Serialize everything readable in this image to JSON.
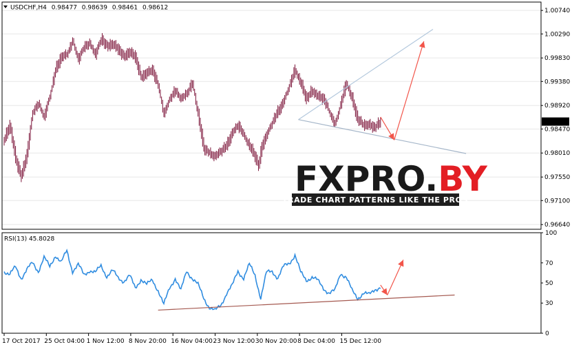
{
  "colors": {
    "background": "#ffffff",
    "frame": "#000000",
    "grid": "#e7e7e7",
    "candle_body": "#7b1338",
    "rsi_line": "#2f8ce0",
    "trend_line_upper": "#b3c8dd",
    "trend_line_lower": "#a5b6c9",
    "rsi_support_line": "#a4584f",
    "arrow": "#f2554a",
    "logo_dark": "#1a1a1a",
    "logo_red": "#e31e24",
    "tag_bar": "#1e1e1e"
  },
  "header": {
    "symbol": "USDCHF,H4",
    "open": "0.98477",
    "high": "0.98639",
    "low": "0.98461",
    "close": "0.98612"
  },
  "watermark": {
    "part1": "FXPRO.",
    "part2": "BY",
    "tagline": "TRADE CHART PATTERNS LIKE THE PROS"
  },
  "chart_data": [
    {
      "type": "candlestick",
      "title": "USDCHF,H4",
      "ylim": [
        0.9655,
        1.009
      ],
      "y_ticks": [
        "1.00740",
        "1.00290",
        "0.99830",
        "0.99380",
        "0.98920",
        "0.98470",
        "0.98010",
        "0.97550",
        "0.97100",
        "0.96640"
      ],
      "current_price": "0.98612",
      "grid": true,
      "close_path": [
        [
          0,
          0.9825
        ],
        [
          5,
          0.9855
        ],
        [
          10,
          0.979
        ],
        [
          15,
          0.9755
        ],
        [
          20,
          0.98
        ],
        [
          25,
          0.988
        ],
        [
          30,
          0.9895
        ],
        [
          35,
          0.987
        ],
        [
          40,
          0.991
        ],
        [
          45,
          0.996
        ],
        [
          50,
          0.9985
        ],
        [
          55,
          0.999
        ],
        [
          60,
          1.0015
        ],
        [
          65,
          0.998
        ],
        [
          70,
          1.0005
        ],
        [
          75,
          1.001
        ],
        [
          80,
          0.999
        ],
        [
          85,
          1.002
        ],
        [
          90,
          1.0005
        ],
        [
          95,
          1.001
        ],
        [
          100,
          1.0
        ],
        [
          105,
          0.9985
        ],
        [
          110,
          0.9995
        ],
        [
          115,
          0.9985
        ],
        [
          120,
          0.9945
        ],
        [
          125,
          0.9955
        ],
        [
          130,
          0.996
        ],
        [
          135,
          0.993
        ],
        [
          140,
          0.9875
        ],
        [
          145,
          0.9905
        ],
        [
          150,
          0.992
        ],
        [
          155,
          0.9905
        ],
        [
          160,
          0.9915
        ],
        [
          165,
          0.9935
        ],
        [
          170,
          0.9875
        ],
        [
          175,
          0.981
        ],
        [
          180,
          0.98
        ],
        [
          185,
          0.9795
        ],
        [
          190,
          0.9805
        ],
        [
          195,
          0.9815
        ],
        [
          200,
          0.984
        ],
        [
          205,
          0.9855
        ],
        [
          210,
          0.9835
        ],
        [
          215,
          0.9815
        ],
        [
          220,
          0.9795
        ],
        [
          223,
          0.9775
        ],
        [
          226,
          0.9815
        ],
        [
          230,
          0.9835
        ],
        [
          235,
          0.986
        ],
        [
          240,
          0.988
        ],
        [
          245,
          0.99
        ],
        [
          250,
          0.993
        ],
        [
          255,
          0.996
        ],
        [
          260,
          0.9935
        ],
        [
          265,
          0.9905
        ],
        [
          270,
          0.992
        ],
        [
          275,
          0.991
        ],
        [
          280,
          0.9905
        ],
        [
          285,
          0.988
        ],
        [
          290,
          0.9855
        ],
        [
          295,
          0.9895
        ],
        [
          300,
          0.9935
        ],
        [
          305,
          0.9905
        ],
        [
          310,
          0.9865
        ],
        [
          315,
          0.9855
        ],
        [
          320,
          0.9855
        ],
        [
          325,
          0.985
        ],
        [
          330,
          0.9861
        ]
      ],
      "x_tick_labels": [
        {
          "bar": 0,
          "label": "17 Oct 2017"
        },
        {
          "bar": 37,
          "label": "25 Oct 04:00"
        },
        {
          "bar": 74,
          "label": "1 Nov 12:00"
        },
        {
          "bar": 111,
          "label": "8 Nov 20:00"
        },
        {
          "bar": 148,
          "label": "16 Nov 04:00"
        },
        {
          "bar": 185,
          "label": "23 Nov 12:00"
        },
        {
          "bar": 222,
          "label": "30 Nov 20:00"
        },
        {
          "bar": 259,
          "label": "8 Dec 04:00"
        },
        {
          "bar": 296,
          "label": "15 Dec 12:00"
        }
      ]
    },
    {
      "type": "line",
      "title": "RSI(13) 45.8028",
      "name": "RSI(13)",
      "ylim": [
        0,
        100
      ],
      "y_ticks": [
        "100",
        "70",
        "50",
        "30",
        "0"
      ],
      "grid": false,
      "values_path": [
        [
          0,
          62
        ],
        [
          5,
          58
        ],
        [
          10,
          66
        ],
        [
          15,
          55
        ],
        [
          20,
          63
        ],
        [
          25,
          70
        ],
        [
          30,
          62
        ],
        [
          35,
          75
        ],
        [
          40,
          66
        ],
        [
          45,
          78
        ],
        [
          50,
          70
        ],
        [
          55,
          82
        ],
        [
          60,
          62
        ],
        [
          65,
          68
        ],
        [
          70,
          58
        ],
        [
          75,
          63
        ],
        [
          80,
          60
        ],
        [
          85,
          67
        ],
        [
          90,
          57
        ],
        [
          95,
          62
        ],
        [
          100,
          55
        ],
        [
          105,
          52
        ],
        [
          110,
          57
        ],
        [
          115,
          45
        ],
        [
          120,
          54
        ],
        [
          125,
          48
        ],
        [
          130,
          53
        ],
        [
          135,
          43
        ],
        [
          140,
          28
        ],
        [
          145,
          45
        ],
        [
          150,
          55
        ],
        [
          155,
          42
        ],
        [
          160,
          62
        ],
        [
          165,
          55
        ],
        [
          170,
          48
        ],
        [
          175,
          35
        ],
        [
          180,
          26
        ],
        [
          185,
          22
        ],
        [
          190,
          28
        ],
        [
          195,
          40
        ],
        [
          200,
          47
        ],
        [
          205,
          62
        ],
        [
          210,
          55
        ],
        [
          215,
          68
        ],
        [
          220,
          58
        ],
        [
          225,
          35
        ],
        [
          230,
          60
        ],
        [
          235,
          62
        ],
        [
          240,
          55
        ],
        [
          245,
          66
        ],
        [
          250,
          70
        ],
        [
          255,
          78
        ],
        [
          260,
          60
        ],
        [
          265,
          53
        ],
        [
          270,
          56
        ],
        [
          275,
          52
        ],
        [
          280,
          45
        ],
        [
          285,
          40
        ],
        [
          290,
          42
        ],
        [
          295,
          60
        ],
        [
          300,
          56
        ],
        [
          305,
          42
        ],
        [
          310,
          35
        ],
        [
          315,
          40
        ],
        [
          320,
          38
        ],
        [
          325,
          44
        ],
        [
          330,
          45.8
        ]
      ]
    }
  ],
  "annotations": {
    "upper_trend": {
      "from": [
        258,
        0.9865
      ],
      "to": [
        376,
        1.0038
      ]
    },
    "lower_trend": {
      "from": [
        258,
        0.9865
      ],
      "to": [
        405,
        0.98
      ]
    },
    "price_arrow_down": {
      "from": [
        330,
        0.987
      ],
      "to": [
        342,
        0.9826
      ]
    },
    "price_arrow_up": {
      "from": [
        342,
        0.9826
      ],
      "to": [
        368,
        1.0015
      ]
    },
    "rsi_support": {
      "from": [
        135,
        23
      ],
      "to": [
        395,
        38
      ]
    },
    "rsi_arrow_down": {
      "from": [
        330,
        48
      ],
      "to": [
        336,
        38
      ]
    },
    "rsi_arrow_up": {
      "from": [
        336,
        38
      ],
      "to": [
        350,
        73
      ]
    }
  }
}
